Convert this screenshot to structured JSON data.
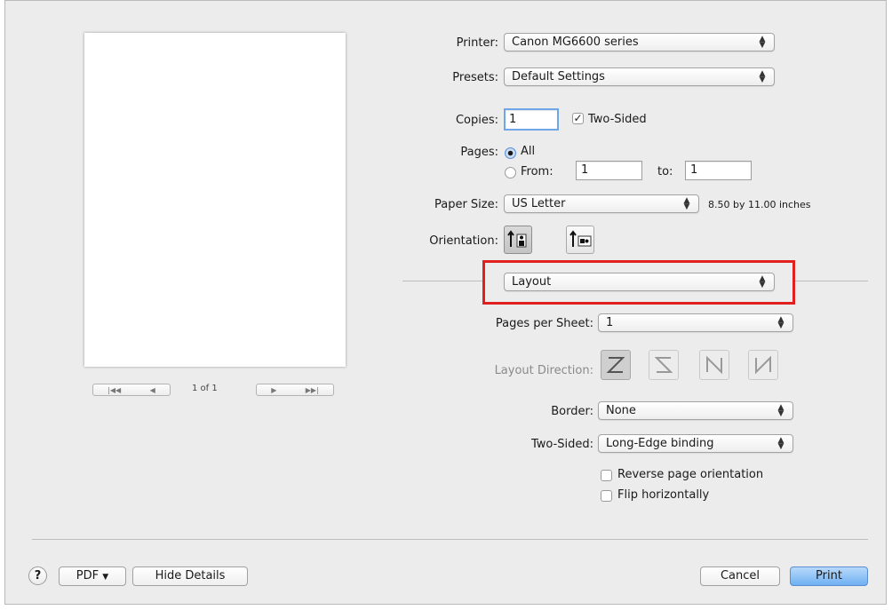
{
  "printer": {
    "label": "Printer:",
    "value": "Canon MG6600 series"
  },
  "presets": {
    "label": "Presets:",
    "value": "Default Settings"
  },
  "copies": {
    "label": "Copies:",
    "value": "1",
    "two_sided_label": "Two-Sided",
    "two_sided_checked": true
  },
  "pages": {
    "label": "Pages:",
    "all_label": "All",
    "from_label": "From:",
    "from_value": "1",
    "to_label": "to:",
    "to_value": "1",
    "selected": "All"
  },
  "paper_size": {
    "label": "Paper Size:",
    "value": "US Letter",
    "dimensions": "8.50 by 11.00 inches"
  },
  "orientation": {
    "label": "Orientation:",
    "options": [
      "portrait-icon",
      "landscape-icon"
    ],
    "selected": "portrait"
  },
  "section_popup": {
    "value": "Layout",
    "highlight_color": "#e0201e"
  },
  "layout": {
    "pages_per_sheet_label": "Pages per Sheet:",
    "pages_per_sheet_value": "1",
    "direction_label": "Layout Direction:",
    "direction_icons": [
      "z-order-icon",
      "s-order-icon",
      "reverse-n-order-icon",
      "n-order-icon"
    ],
    "border_label": "Border:",
    "border_value": "None",
    "two_sided_label": "Two-Sided:",
    "two_sided_value": "Long-Edge binding",
    "reverse_label": "Reverse page orientation",
    "flip_label": "Flip horizontally"
  },
  "preview": {
    "page_indicator": "1 of 1"
  },
  "footer": {
    "help_label": "?",
    "pdf_label": "PDF",
    "hide_details_label": "Hide Details",
    "cancel_label": "Cancel",
    "print_label": "Print"
  },
  "colors": {
    "accent": "#6fb0f2",
    "highlight": "#e0201e",
    "background": "#ececec"
  }
}
